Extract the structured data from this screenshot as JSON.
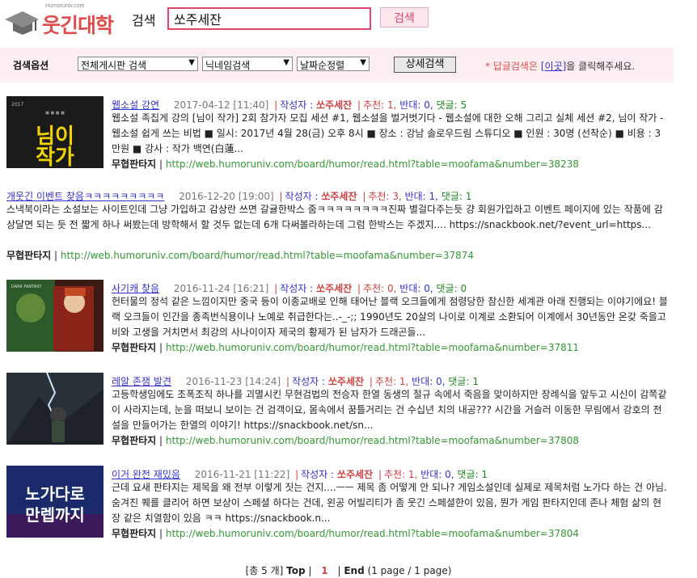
{
  "header": {
    "logo_small": "Humoruniv.com",
    "logo_text": "웃긴대학",
    "search_label": "검색",
    "search_value": "쏘주세잔",
    "search_button": "검색"
  },
  "options": {
    "label": "검색옵션",
    "board_select": "전체게시판 검색",
    "name_select": "닉네임검색",
    "sort_select": "날짜순정렬",
    "advanced_button": "상세검색",
    "note_prefix": "* 답글검색은",
    "note_link": "[이곳]",
    "note_suffix": "을 클릭해주세요."
  },
  "labels": {
    "author_label": "작성자 :",
    "sep": "|"
  },
  "results": [
    {
      "title": "웹소설 강연",
      "date": "2017-04-12 [11:40]",
      "author": "쏘주세잔",
      "rec": "추천: 1,",
      "opp": "반대: 0,",
      "cmt": "댓글: 5",
      "snippet": "웹소설 족집게 강의 [님이 작가] 2회 참가자 모집   세션 #1, 웹소설을 벌거벗기다 - 웹소설에 대한 오해 그리고 실체 세션 #2, 님이 작가 - 웹소설 쉽게 쓰는 비법   ■ 일시: 2017년 4월 28(금) 오후 8시 ■ 장소 : 강남 솔로우드림 스튜디오 ■ 인원 : 30명 (선착순) ■ 비용 : 3만원 ■ 강사 : 작가 백연(白蓮...",
      "board": "무협판타지",
      "url": "http://web.humoruniv.com/board/humor/read.html?table=moofama&number=38238",
      "thumb_text": "님이작가"
    },
    {
      "title": "개웃긴 이벤트 찾음ㅋㅋㅋㅋㅋㅋㅋㅋㅋ",
      "date": "2016-12-20 [19:00]",
      "author": "쏘주세잔",
      "rec": "추천: 3,",
      "opp": "반대: 1,",
      "cmt": "댓글: 1",
      "snippet": "스낵북이라는 소설보는 사이트인데 그냥 가입하고 감상란 쓰면 갈귤한박스 줌ㅋㅋㅋㅋㅋㅋㅋㅋ진짜 별걸다주는듯 걍 회원가입하고 이벤트 페이지에 있는 작품에 감상달면 되는 듯 전 짧게 하나 써봤는데 방학해서 할 것두 없는데 6개 다써볼라하는데 그럼 한박스는 주겠지.... https://snackbook.net/?event_url=https...",
      "board": "무협판타지",
      "url": "http://web.humoruniv.com/board/humor/read.html?table=moofama&number=37874",
      "thumb_text": ""
    },
    {
      "title": "사기캐 찾음",
      "date": "2016-11-24 [16:21]",
      "author": "쏘주세잔",
      "rec": "추천: 0,",
      "opp": "반대: 0,",
      "cmt": "댓글: 0",
      "snippet": "헌터물의 정석 같은 느낌이지만 중국 등이 이종교배로 인해 태어난 블랙 오크들에게 점령당한 참신한 세계관 아래 진행되는 이야기에요! 블랙 오크들이 인간을 종족번식용이나 노예로 취급한다는..-_-;; 1990년도 20살의 나이로 이계로 소환되어 이계에서 30년동안 온갖 죽을고비와 고생을 거치면서 최강의 사나이이자 제국의 황제가 된 남자가 드래곤들...",
      "board": "무협판타지",
      "url": "http://web.humoruniv.com/board/humor/read.html?table=moofama&number=37811",
      "thumb_text": ""
    },
    {
      "title": "레알 존잼 발견",
      "date": "2016-11-23 [14:24]",
      "author": "쏘주세잔",
      "rec": "추천: 1,",
      "opp": "반대: 0,",
      "cmt": "댓글: 1",
      "snippet": "고등학생임에도 조폭조직 하나를 괴멸시킨 무현검법의 전승자 한열 동생의 절규 속에서 죽음을 맞이하지만 장례식을 앞두고 시신이 감쪽같이 사라지는데, 눈을 떠보니 보이는 건 검객이요, 몸속에서 꿈틀거리는 건 수십년 치의 내공??? 시간을 거슬러 이동한 무림에서 강호의 전설을 만들어가는 한열의 이야기! https://snackbook.net/sn...",
      "board": "무협판타지",
      "url": "http://web.humoruniv.com/board/humor/read.html?table=moofama&number=37808",
      "thumb_text": ""
    },
    {
      "title": "이거 완전 재밌음",
      "date": "2016-11-21 [11:22]",
      "author": "쏘주세잔",
      "rec": "추천: 1,",
      "opp": "반대: 0,",
      "cmt": "댓글: 1",
      "snippet": "근데 요새 판타지는 제목을 왜 전부 이렇게 짓는 건지....ㅡㅡ 제목 좀 어떻게 안 되나? 게임소설인데 실제로 제목처럼 노가다 하는 건 아님. 숨겨진 퀘를 클리어 하면 보상이 스페셜 하다는 건데, 왼공 어빌리티가 좀 웃긴 스페셜한이 있음, 뭔가 게임 판타지인데 존나 체험 삶의 현장 같은 치열함이 있음 ㅋㅋ https://snackbook.n...",
      "board": "무협판타지",
      "url": "http://web.humoruniv.com/board/humor/read.html?table=moofama&number=37804",
      "thumb_text": "노가다로만렙까지"
    }
  ],
  "pagination": {
    "total": "[총 5 개]",
    "top": "Top",
    "sep": "|",
    "current": "1",
    "end": "End",
    "info": "(1 page / 1 page)"
  }
}
